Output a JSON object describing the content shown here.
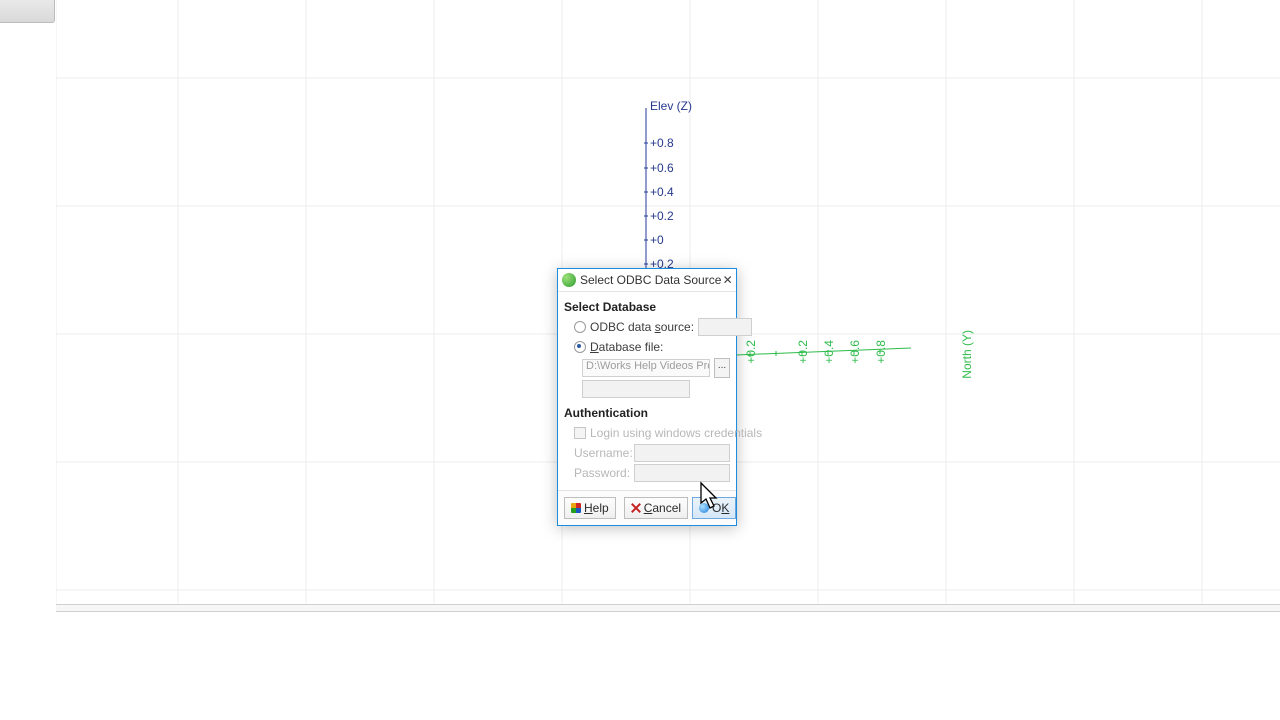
{
  "toolbar": {
    "stub": ""
  },
  "axes": {
    "z_label": "Elev (Z)",
    "z_ticks": [
      "+0.8",
      "+0.6",
      "+0.4",
      "+0.2",
      "+0",
      "+0.2"
    ],
    "y_label": "North (Y)",
    "y_ticks": [
      "+0.2",
      "+0.2",
      "+0.4",
      "+0.6",
      "+0.8"
    ]
  },
  "dialog": {
    "title": "Select ODBC Data Source",
    "section_db": "Select Database",
    "radio_source_prefix": "ODBC data ",
    "radio_source_mn": "s",
    "radio_source_suffix": "ource:",
    "radio_file_mn": "D",
    "radio_file_suffix": "atabase file:",
    "db_file_value": "D:\\Works Help Videos Project",
    "browse_label": "...",
    "section_auth": "Authentication",
    "login_windows": "Login using windows credentials",
    "username_label": "Username:",
    "password_label": "Password:",
    "help_mn": "H",
    "help_suffix": "elp",
    "cancel_mn": "C",
    "cancel_suffix": "ancel",
    "ok_prefix": "O",
    "ok_mn": "K"
  }
}
